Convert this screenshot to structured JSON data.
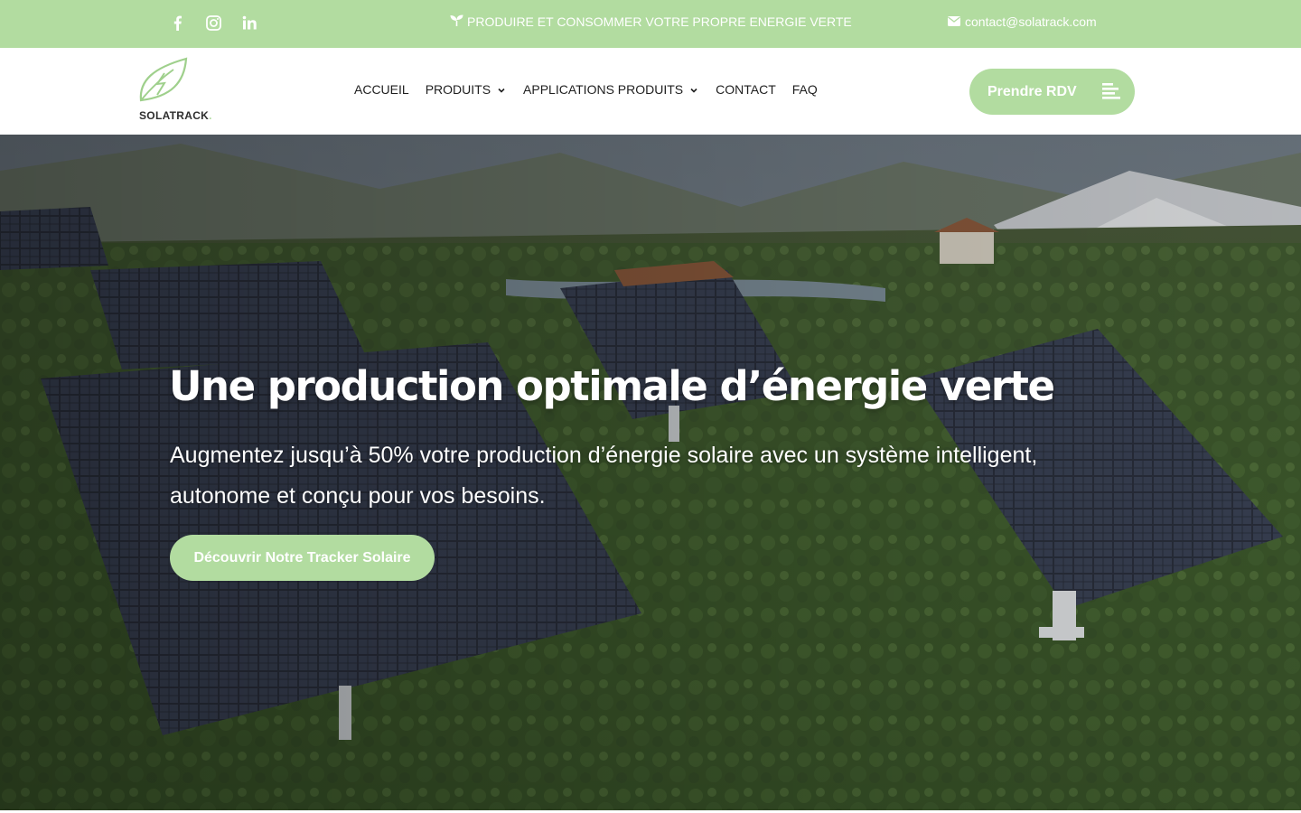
{
  "topbar": {
    "background_color": "#b2dca0",
    "social": [
      {
        "icon": "facebook-icon"
      },
      {
        "icon": "instagram-icon"
      },
      {
        "icon": "linkedin-icon"
      }
    ],
    "tagline_icon": "sprout-icon",
    "tagline": "PRODUIRE ET CONSOMMER VOTRE PROPRE ENERGIE VERTE",
    "email_icon": "envelope-icon",
    "email": "contact@solatrack.com"
  },
  "header": {
    "logo_text": "SOLATRACK",
    "nav": [
      {
        "label": "ACCUEIL",
        "has_dropdown": false
      },
      {
        "label": "PRODUITS",
        "has_dropdown": true
      },
      {
        "label": "APPLICATIONS PRODUITS",
        "has_dropdown": true
      },
      {
        "label": "CONTACT",
        "has_dropdown": false
      },
      {
        "label": "FAQ",
        "has_dropdown": false
      }
    ],
    "cta_label": "Prendre RDV",
    "cta_icon": "menu-lines-icon"
  },
  "hero": {
    "title": "Une production optimale d’énergie verte",
    "subtitle": "Augmentez jusqu’à 50% votre production d’énergie solaire avec un système intelligent, autonome et conçu pour vos besoins.",
    "button_label": "Découvrir Notre Tracker Solaire"
  },
  "colors": {
    "accent": "#b2dca0",
    "nav_text": "#1f1f1f"
  }
}
